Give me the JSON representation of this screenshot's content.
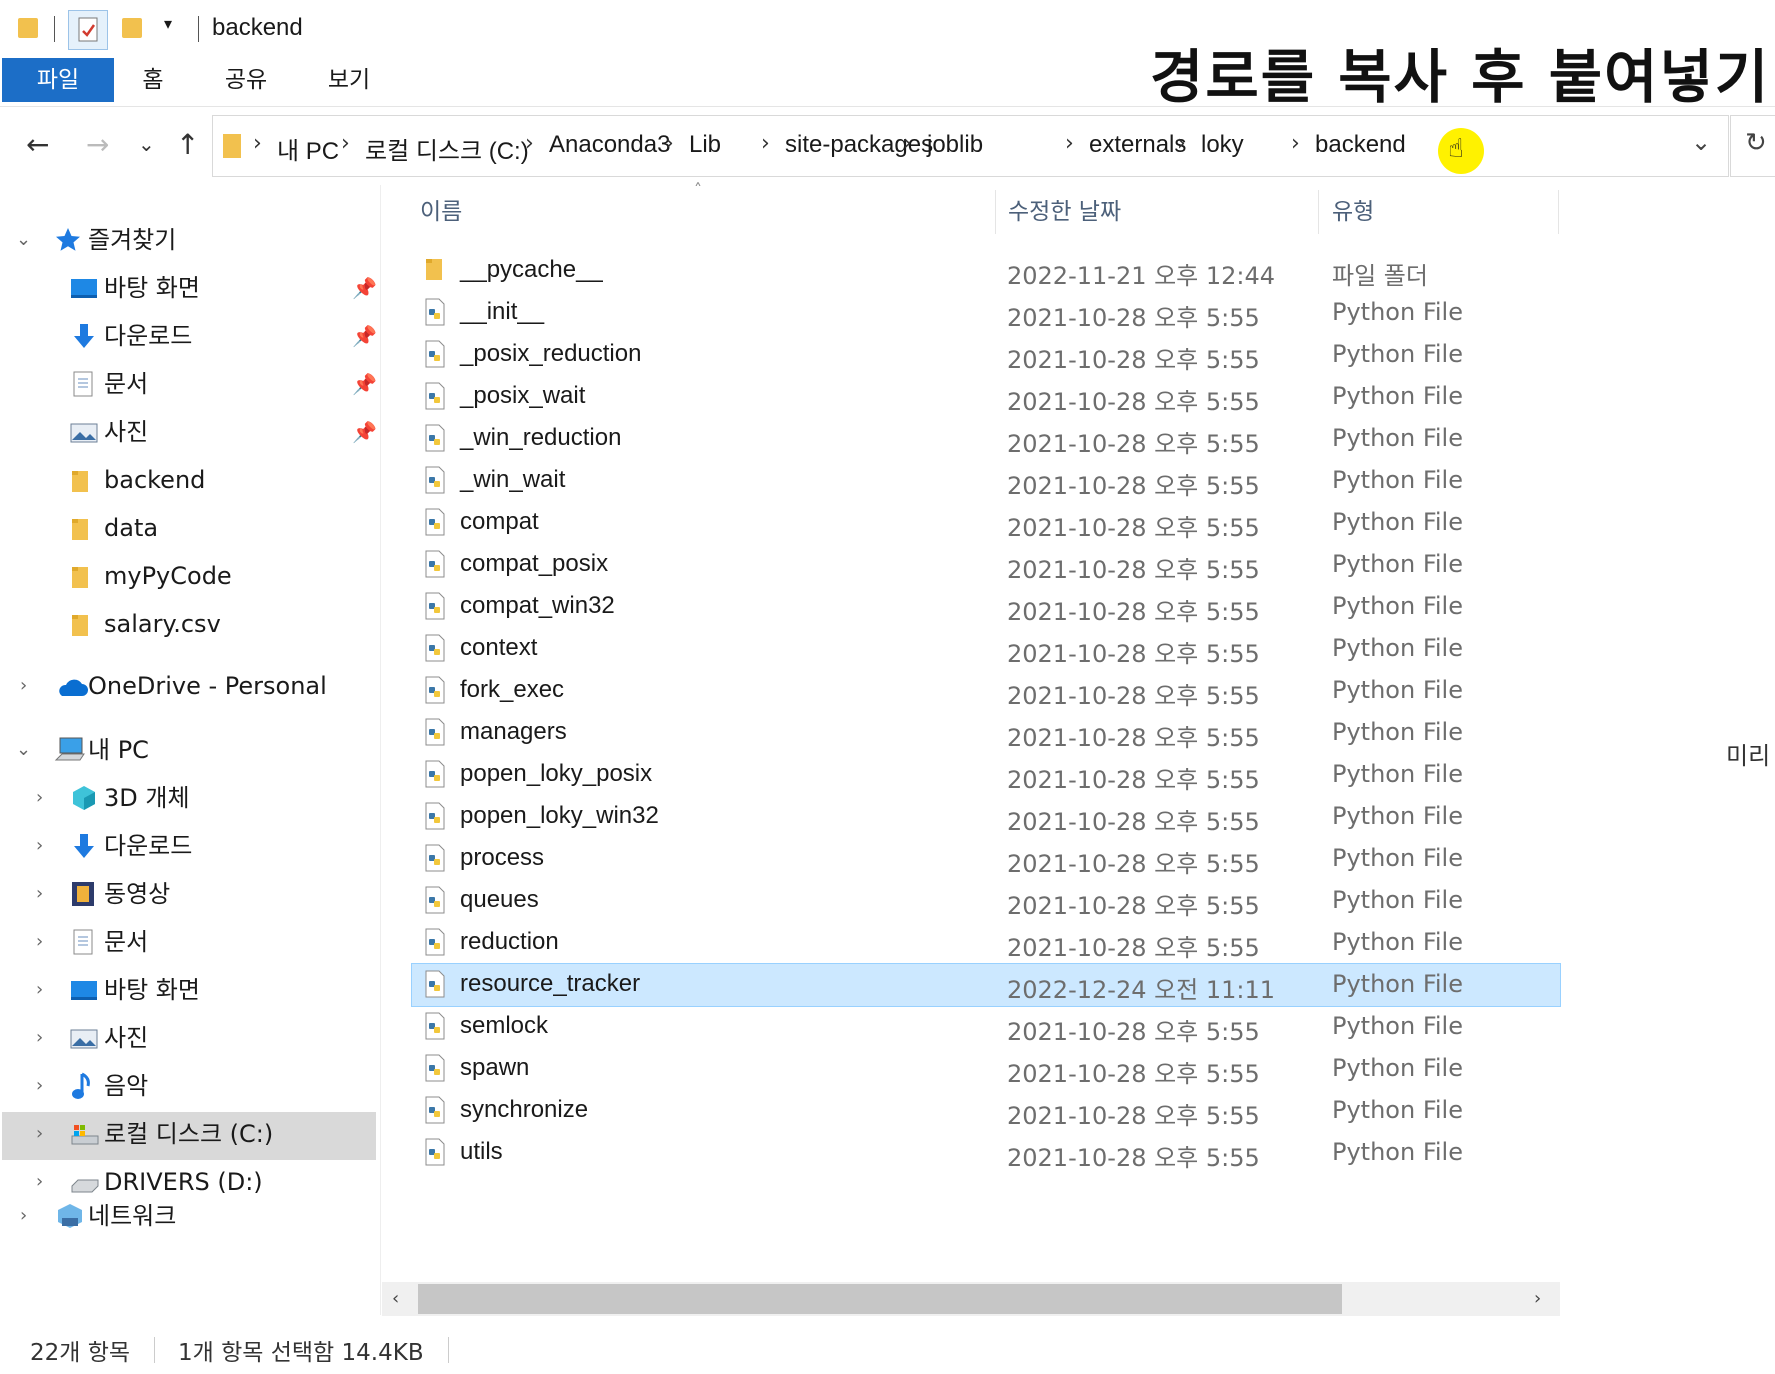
{
  "window": {
    "title": "backend",
    "overlay_caption": "경로를 복사 후 붙여넣기"
  },
  "ribbon": {
    "tabs": [
      "파일",
      "홈",
      "공유",
      "보기"
    ]
  },
  "address": {
    "crumbs": [
      "내 PC",
      "로컬 디스크 (C:)",
      "Anaconda3",
      "Lib",
      "site-packages",
      "joblib",
      "externals",
      "loky",
      "backend"
    ]
  },
  "sidebar": {
    "quick_access": "즐겨찾기",
    "quick_items": [
      {
        "label": "바탕 화면",
        "icon": "desktop-icon",
        "pinned": true
      },
      {
        "label": "다운로드",
        "icon": "download-icon",
        "pinned": true
      },
      {
        "label": "문서",
        "icon": "document-icon",
        "pinned": true
      },
      {
        "label": "사진",
        "icon": "pictures-icon",
        "pinned": true
      },
      {
        "label": "backend",
        "icon": "folder-icon",
        "pinned": false
      },
      {
        "label": "data",
        "icon": "folder-icon",
        "pinned": false
      },
      {
        "label": "myPyCode",
        "icon": "folder-icon",
        "pinned": false
      },
      {
        "label": "salary.csv",
        "icon": "folder-icon",
        "pinned": false
      }
    ],
    "onedrive": "OneDrive - Personal",
    "this_pc": "내 PC",
    "pc_items": [
      {
        "label": "3D 개체",
        "icon": "3d-objects-icon"
      },
      {
        "label": "다운로드",
        "icon": "download-icon"
      },
      {
        "label": "동영상",
        "icon": "video-icon"
      },
      {
        "label": "문서",
        "icon": "document-icon"
      },
      {
        "label": "바탕 화면",
        "icon": "desktop-icon"
      },
      {
        "label": "사진",
        "icon": "pictures-icon"
      },
      {
        "label": "음악",
        "icon": "music-icon"
      },
      {
        "label": "로컬 디스크 (C:)",
        "icon": "local-disk-icon"
      },
      {
        "label": "DRIVERS (D:)",
        "icon": "drive-icon"
      }
    ],
    "network": "네트워크"
  },
  "columns": {
    "name": "이름",
    "date": "수정한 날짜",
    "type": "유형"
  },
  "files": [
    {
      "name": "__pycache__",
      "date": "2022-11-21 오후 12:44",
      "type": "파일 폴더",
      "kind": "folder"
    },
    {
      "name": "__init__",
      "date": "2021-10-28 오후 5:55",
      "type": "Python File",
      "kind": "py"
    },
    {
      "name": "_posix_reduction",
      "date": "2021-10-28 오후 5:55",
      "type": "Python File",
      "kind": "py"
    },
    {
      "name": "_posix_wait",
      "date": "2021-10-28 오후 5:55",
      "type": "Python File",
      "kind": "py"
    },
    {
      "name": "_win_reduction",
      "date": "2021-10-28 오후 5:55",
      "type": "Python File",
      "kind": "py"
    },
    {
      "name": "_win_wait",
      "date": "2021-10-28 오후 5:55",
      "type": "Python File",
      "kind": "py"
    },
    {
      "name": "compat",
      "date": "2021-10-28 오후 5:55",
      "type": "Python File",
      "kind": "py"
    },
    {
      "name": "compat_posix",
      "date": "2021-10-28 오후 5:55",
      "type": "Python File",
      "kind": "py"
    },
    {
      "name": "compat_win32",
      "date": "2021-10-28 오후 5:55",
      "type": "Python File",
      "kind": "py"
    },
    {
      "name": "context",
      "date": "2021-10-28 오후 5:55",
      "type": "Python File",
      "kind": "py"
    },
    {
      "name": "fork_exec",
      "date": "2021-10-28 오후 5:55",
      "type": "Python File",
      "kind": "py"
    },
    {
      "name": "managers",
      "date": "2021-10-28 오후 5:55",
      "type": "Python File",
      "kind": "py"
    },
    {
      "name": "popen_loky_posix",
      "date": "2021-10-28 오후 5:55",
      "type": "Python File",
      "kind": "py"
    },
    {
      "name": "popen_loky_win32",
      "date": "2021-10-28 오후 5:55",
      "type": "Python File",
      "kind": "py"
    },
    {
      "name": "process",
      "date": "2021-10-28 오후 5:55",
      "type": "Python File",
      "kind": "py"
    },
    {
      "name": "queues",
      "date": "2021-10-28 오후 5:55",
      "type": "Python File",
      "kind": "py"
    },
    {
      "name": "reduction",
      "date": "2021-10-28 오후 5:55",
      "type": "Python File",
      "kind": "py"
    },
    {
      "name": "resource_tracker",
      "date": "2022-12-24 오전 11:11",
      "type": "Python File",
      "kind": "py",
      "selected": true
    },
    {
      "name": "semlock",
      "date": "2021-10-28 오후 5:55",
      "type": "Python File",
      "kind": "py"
    },
    {
      "name": "spawn",
      "date": "2021-10-28 오후 5:55",
      "type": "Python File",
      "kind": "py"
    },
    {
      "name": "synchronize",
      "date": "2021-10-28 오후 5:55",
      "type": "Python File",
      "kind": "py"
    },
    {
      "name": "utils",
      "date": "2021-10-28 오후 5:55",
      "type": "Python File",
      "kind": "py"
    }
  ],
  "status": {
    "count": "22개 항목",
    "selection": "1개 항목 선택함 14.4KB"
  },
  "preview_label": "미리",
  "colors": {
    "accent": "#1c6ec7",
    "selection": "#cce8ff",
    "folder": "#f2c14e",
    "highlight": "#fff200"
  }
}
